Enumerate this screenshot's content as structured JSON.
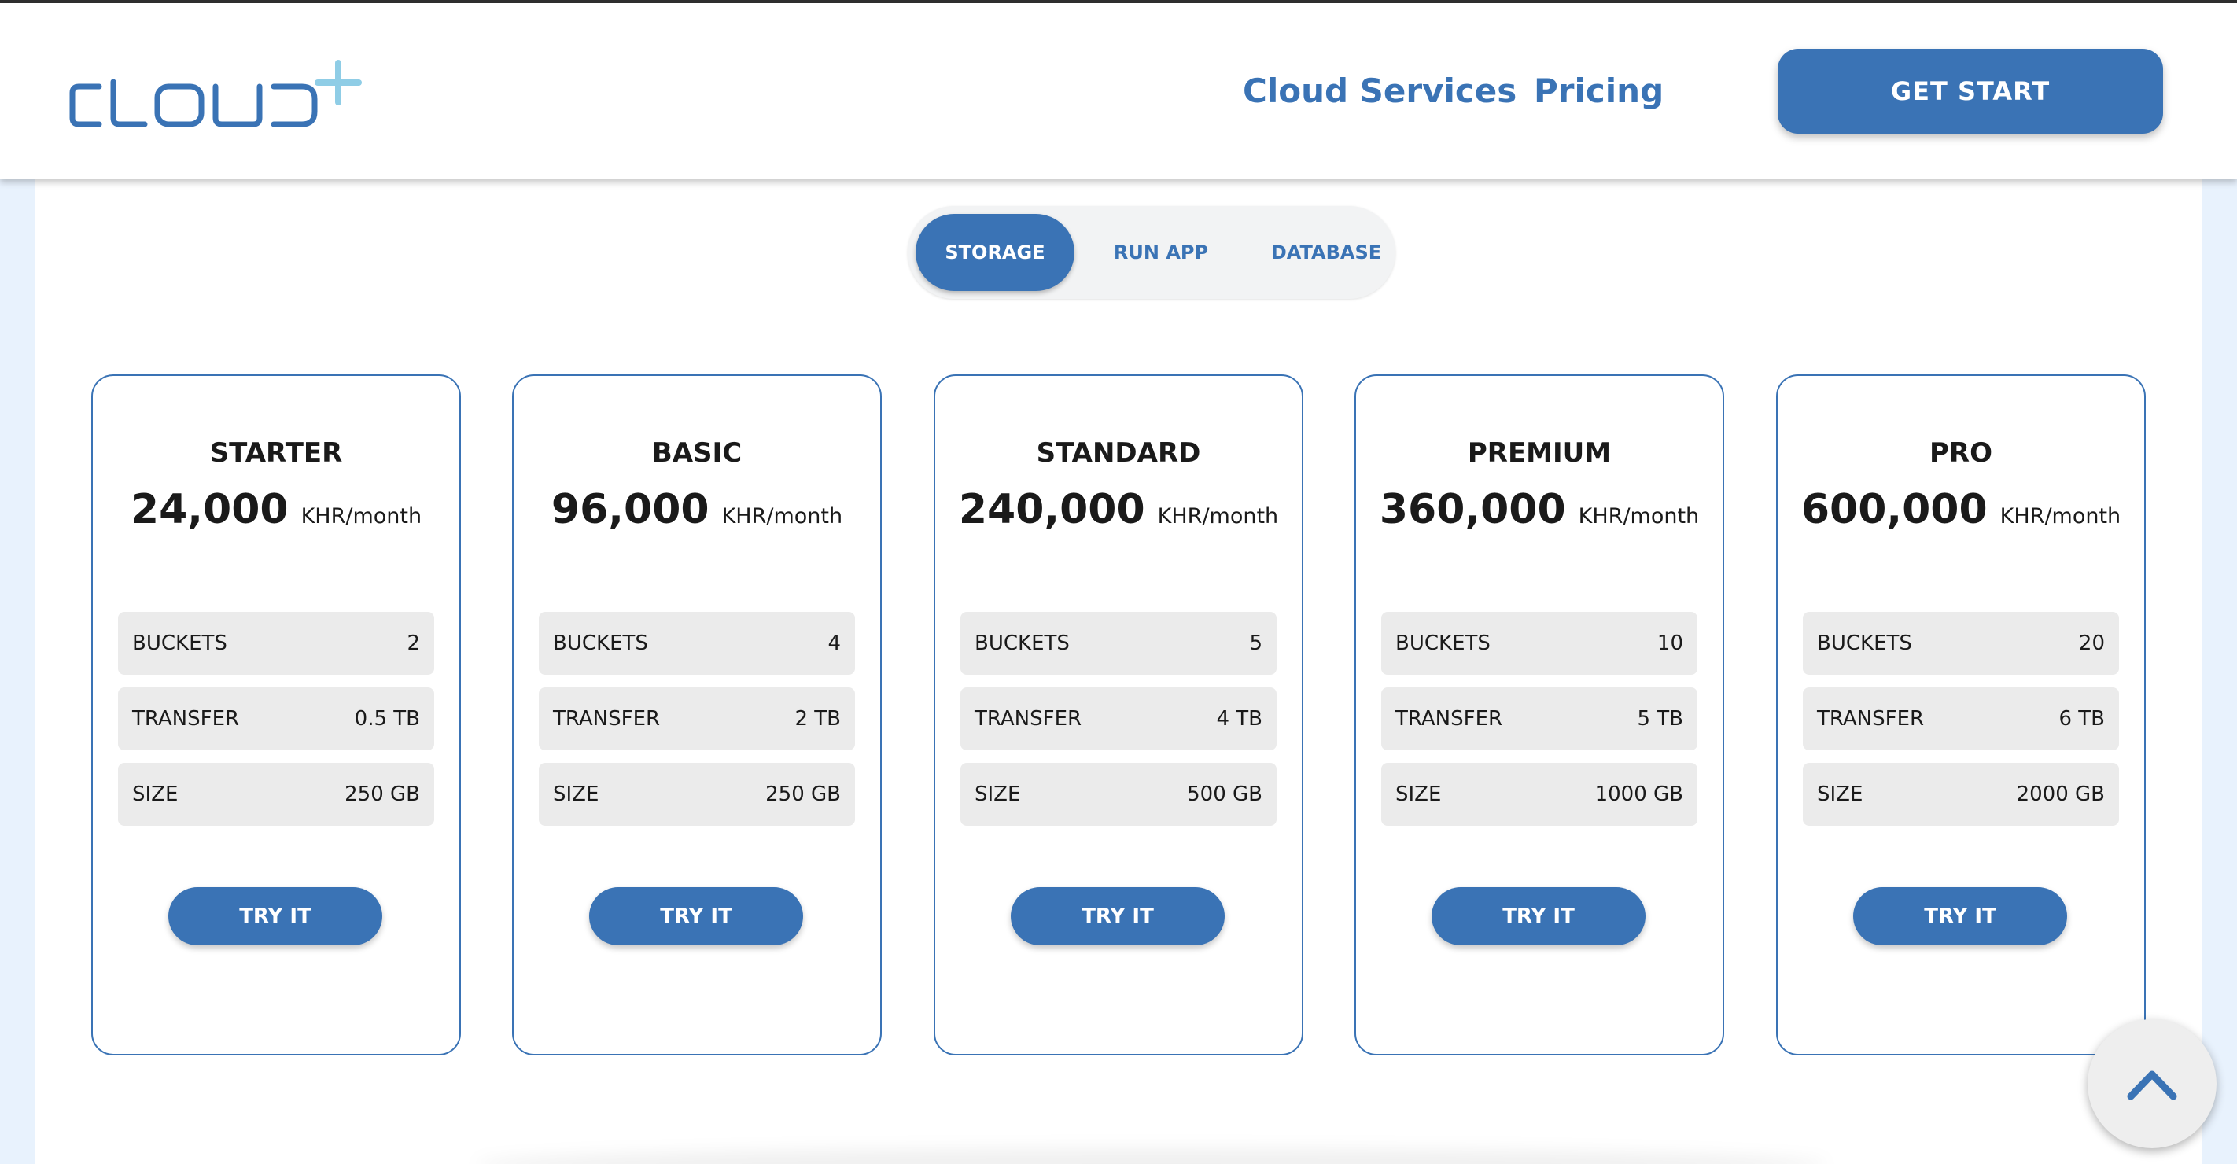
{
  "header": {
    "logo_text": "CLOUD+",
    "nav": [
      "Cloud Services",
      "Pricing"
    ],
    "cta_label": "GET START"
  },
  "tabs": [
    {
      "label": "STORAGE",
      "active": true
    },
    {
      "label": "RUN APP",
      "active": false
    },
    {
      "label": "DATABASE",
      "active": false
    }
  ],
  "plans": [
    {
      "name": "STARTER",
      "price": "24,000",
      "unit": "KHR/month",
      "specs": [
        {
          "label": "BUCKETS",
          "value": "2"
        },
        {
          "label": "TRANSFER",
          "value": "0.5 TB"
        },
        {
          "label": "SIZE",
          "value": "250 GB"
        }
      ],
      "button": "TRY IT"
    },
    {
      "name": "BASIC",
      "price": "96,000",
      "unit": "KHR/month",
      "specs": [
        {
          "label": "BUCKETS",
          "value": "4"
        },
        {
          "label": "TRANSFER",
          "value": "2 TB"
        },
        {
          "label": "SIZE",
          "value": "250 GB"
        }
      ],
      "button": "TRY IT"
    },
    {
      "name": "STANDARD",
      "price": "240,000",
      "unit": "KHR/month",
      "specs": [
        {
          "label": "BUCKETS",
          "value": "5"
        },
        {
          "label": "TRANSFER",
          "value": "4 TB"
        },
        {
          "label": "SIZE",
          "value": "500 GB"
        }
      ],
      "button": "TRY IT"
    },
    {
      "name": "PREMIUM",
      "price": "360,000",
      "unit": "KHR/month",
      "specs": [
        {
          "label": "BUCKETS",
          "value": "10"
        },
        {
          "label": "TRANSFER",
          "value": "5 TB"
        },
        {
          "label": "SIZE",
          "value": "1000 GB"
        }
      ],
      "button": "TRY IT"
    },
    {
      "name": "PRO",
      "price": "600,000",
      "unit": "KHR/month",
      "specs": [
        {
          "label": "BUCKETS",
          "value": "20"
        },
        {
          "label": "TRANSFER",
          "value": "6 TB"
        },
        {
          "label": "SIZE",
          "value": "2000 GB"
        }
      ],
      "button": "TRY IT"
    }
  ],
  "icons": {
    "logo": "cloud-plus-logo",
    "scroll_top": "chevron-up-icon"
  },
  "colors": {
    "accent": "#3a73b5",
    "logo_plus": "#8fcde6",
    "page_bg": "#e8f2fd",
    "spec_bg": "#ebebeb"
  }
}
